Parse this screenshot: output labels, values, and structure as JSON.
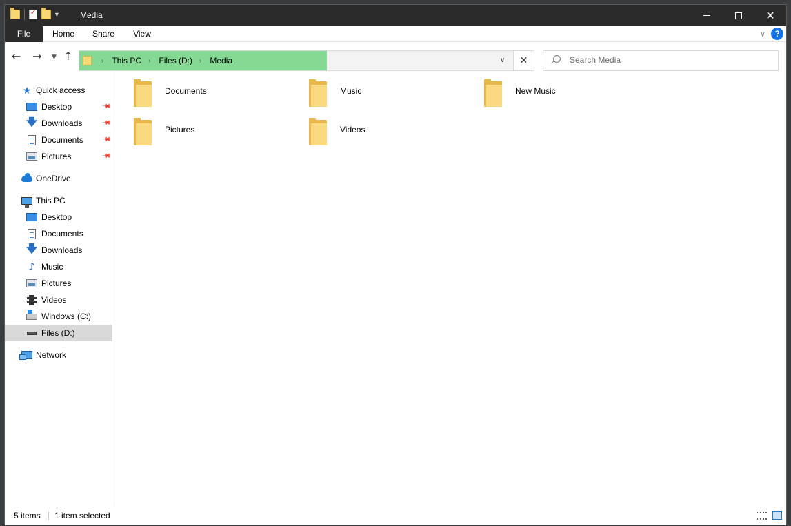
{
  "window": {
    "title": "Media"
  },
  "ribbon": {
    "tabs": [
      "File",
      "Home",
      "Share",
      "View"
    ]
  },
  "address": {
    "crumbs": [
      "This PC",
      "Files (D:)",
      "Media"
    ],
    "progress_fraction": 0.57
  },
  "search": {
    "placeholder": "Search Media"
  },
  "sidebar": {
    "items": [
      {
        "label": "Quick access",
        "icon": "star-icon",
        "pinned": false,
        "selected": false
      },
      {
        "label": "Desktop",
        "icon": "desktop-icon",
        "pinned": true,
        "selected": false
      },
      {
        "label": "Downloads",
        "icon": "download-arrow-icon",
        "pinned": true,
        "selected": false
      },
      {
        "label": "Documents",
        "icon": "document-icon",
        "pinned": true,
        "selected": false
      },
      {
        "label": "Pictures",
        "icon": "pictures-icon",
        "pinned": true,
        "selected": false
      },
      {
        "label": "OneDrive",
        "icon": "cloud-icon",
        "pinned": false,
        "selected": false
      },
      {
        "label": "This PC",
        "icon": "computer-icon",
        "pinned": false,
        "selected": false
      },
      {
        "label": "Desktop",
        "icon": "desktop-icon",
        "pinned": false,
        "selected": false
      },
      {
        "label": "Documents",
        "icon": "document-icon",
        "pinned": false,
        "selected": false
      },
      {
        "label": "Downloads",
        "icon": "download-arrow-icon",
        "pinned": false,
        "selected": false
      },
      {
        "label": "Music",
        "icon": "music-note-icon",
        "pinned": false,
        "selected": false
      },
      {
        "label": "Pictures",
        "icon": "pictures-icon",
        "pinned": false,
        "selected": false
      },
      {
        "label": "Videos",
        "icon": "film-icon",
        "pinned": false,
        "selected": false
      },
      {
        "label": "Windows (C:)",
        "icon": "windows-drive-icon",
        "pinned": false,
        "selected": false
      },
      {
        "label": "Files (D:)",
        "icon": "drive-icon",
        "pinned": false,
        "selected": true
      },
      {
        "label": "Network",
        "icon": "network-icon",
        "pinned": false,
        "selected": false
      }
    ]
  },
  "folders": [
    "Documents",
    "Music",
    "New Music",
    "Pictures",
    "Videos"
  ],
  "status": {
    "count": "5 items",
    "selection": "1 item selected"
  },
  "colors": {
    "accent": "#1473e6",
    "address_progress": "#85d994",
    "folder": "#fbd981",
    "titlebar": "#2b2b2b",
    "selection": "#d9d9d9"
  }
}
